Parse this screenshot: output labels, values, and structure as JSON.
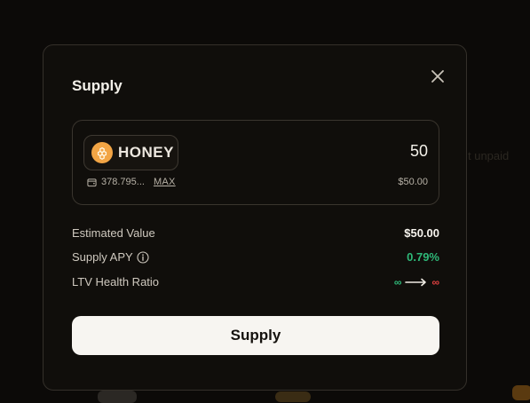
{
  "background": {
    "hint_right": "t unpaid"
  },
  "modal": {
    "title": "Supply",
    "close_icon": "close-icon",
    "token": {
      "symbol": "HONEY",
      "icon": "honey-token-icon"
    },
    "amount": "50",
    "balance": "378.795...",
    "max_label": "MAX",
    "amount_usd": "$50.00",
    "details": {
      "estimated_value_label": "Estimated Value",
      "estimated_value": "$50.00",
      "supply_apy_label": "Supply APY",
      "supply_apy": "0.79%",
      "ltv_label": "LTV Health Ratio",
      "ltv_from": "∞",
      "ltv_to": "∞"
    },
    "submit_label": "Supply"
  },
  "colors": {
    "positive": "#2eb878",
    "negative": "#e04040",
    "button_bg": "#f7f5f1"
  }
}
